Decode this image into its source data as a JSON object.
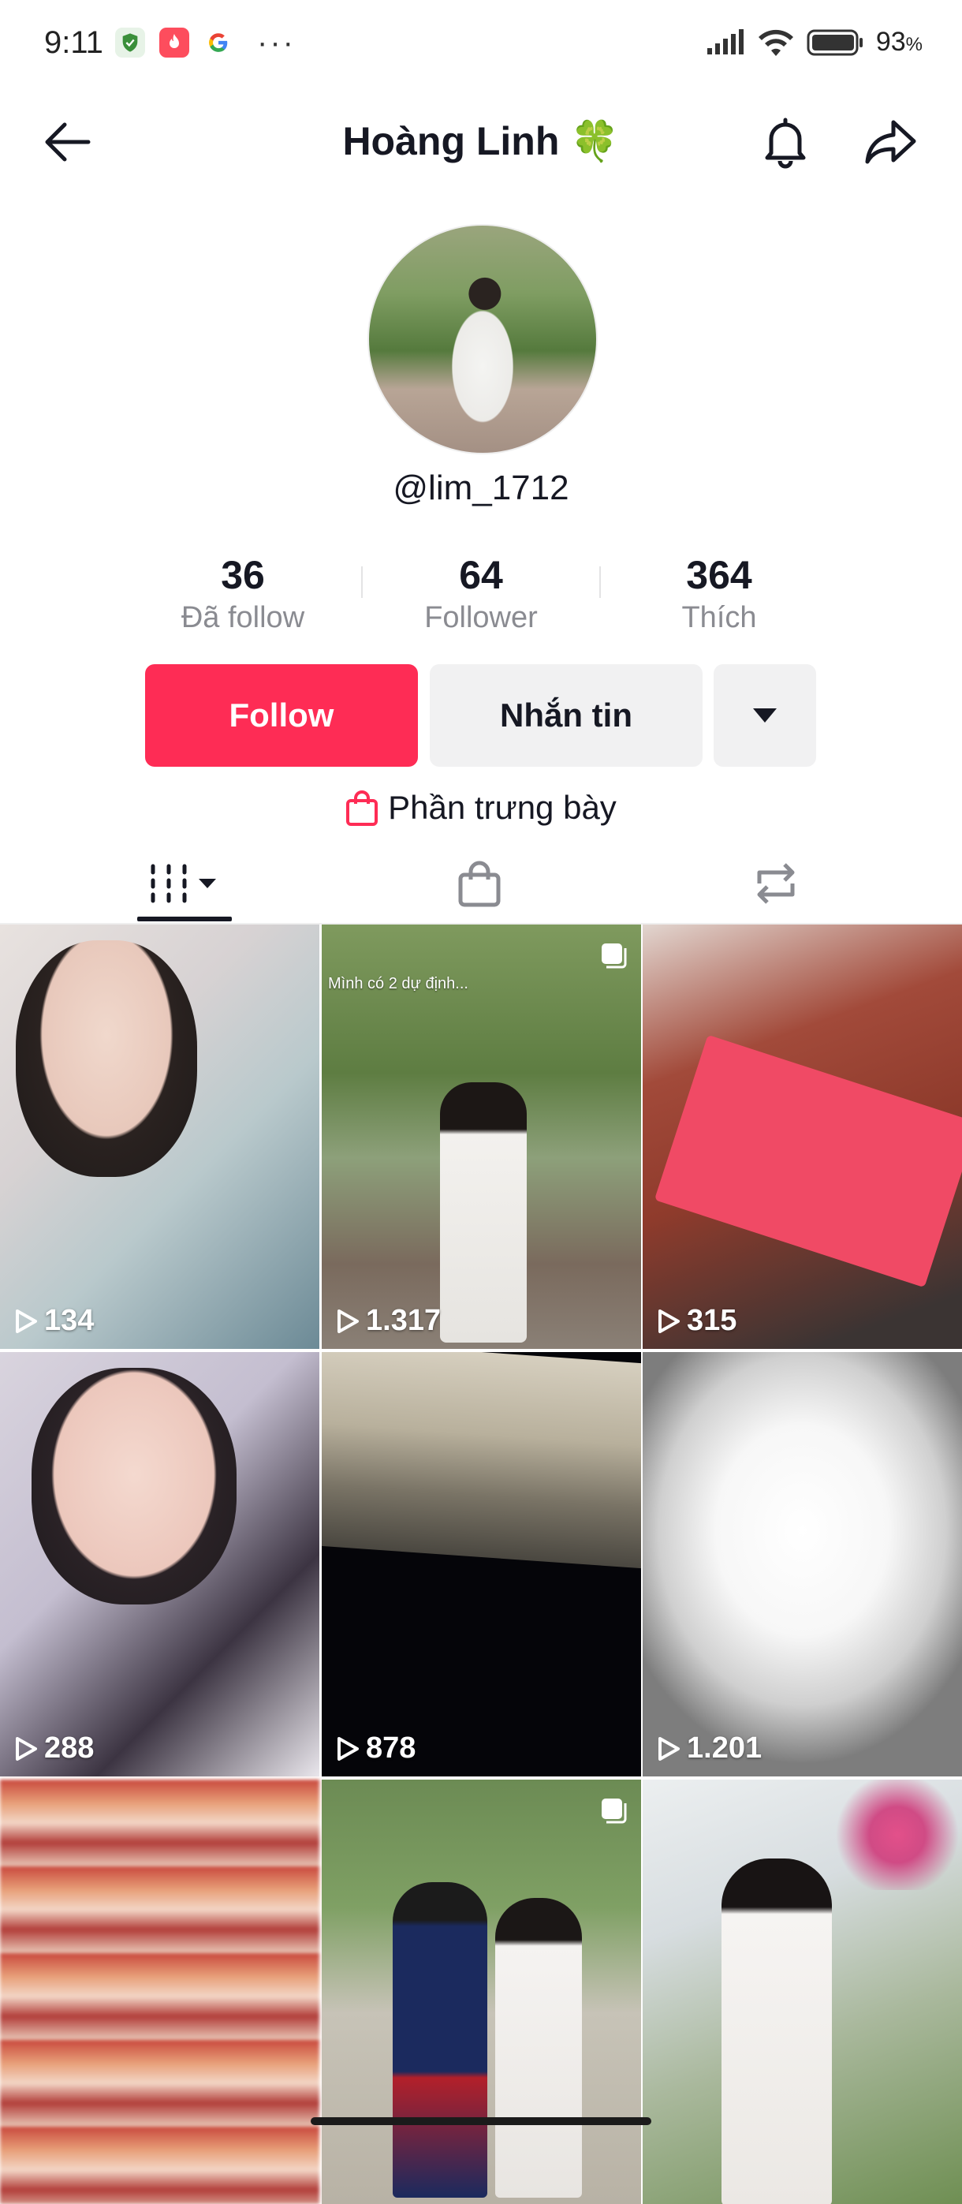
{
  "status_bar": {
    "time": "9:11",
    "battery": "93",
    "battery_unit": "%",
    "more": "···"
  },
  "header": {
    "title": "Hoàng Linh 🍀"
  },
  "profile": {
    "handle": "@lim_1712",
    "stats": [
      {
        "value": "36",
        "label": "Đã follow"
      },
      {
        "value": "64",
        "label": "Follower"
      },
      {
        "value": "364",
        "label": "Thích"
      }
    ]
  },
  "actions": {
    "follow": "Follow",
    "message": "Nhắn tin"
  },
  "showcase": {
    "label": "Phần trưng bày"
  },
  "videos": [
    {
      "views": "134",
      "caption": ""
    },
    {
      "views": "1.317",
      "caption": "Mình có 2 dự định..."
    },
    {
      "views": "315",
      "caption": ""
    },
    {
      "views": "288",
      "caption": ""
    },
    {
      "views": "878",
      "caption": ""
    },
    {
      "views": "1.201",
      "caption": ""
    },
    {
      "views": "",
      "caption": ""
    },
    {
      "views": "",
      "caption": ""
    },
    {
      "views": "",
      "caption": ""
    }
  ],
  "colors": {
    "accent": "#fe2c55",
    "secondary_button": "#f1f1f2",
    "muted_text": "#8a8b91"
  }
}
